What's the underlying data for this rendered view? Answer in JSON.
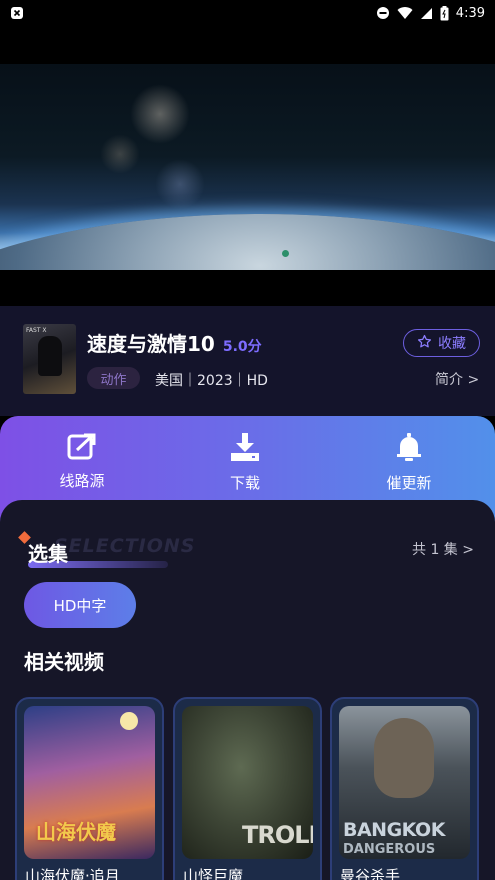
{
  "status_bar": {
    "time": "4:39"
  },
  "movie": {
    "title": "速度与激情10",
    "score": "5.0分",
    "genre": "动作",
    "meta": "美国｜2023｜HD",
    "favorite_label": "收藏",
    "intro_label": "简介 >",
    "poster_tag": "FAST X"
  },
  "actions": [
    {
      "label": "线路源",
      "icon": "external-link-icon"
    },
    {
      "label": "下载",
      "icon": "download-icon"
    },
    {
      "label": "催更新",
      "icon": "bell-icon"
    }
  ],
  "episodes": {
    "title": "选集",
    "watermark": "SELECTIONS",
    "count_label": "共 1 集 >",
    "items": [
      "HD中字"
    ]
  },
  "related": {
    "title": "相关视频",
    "items": [
      {
        "name": "山海伏魔·追月",
        "cover_text": "山海伏魔"
      },
      {
        "name": "山怪巨魔",
        "cover_text": "TROLL"
      },
      {
        "name": "曼谷杀手",
        "cover_text": "BANGKOK",
        "cover_text_2": "DANGEROUS"
      }
    ]
  },
  "colors": {
    "accent": "#7d6cff",
    "panel_bg": "#161628",
    "info_bg": "#14142b"
  }
}
